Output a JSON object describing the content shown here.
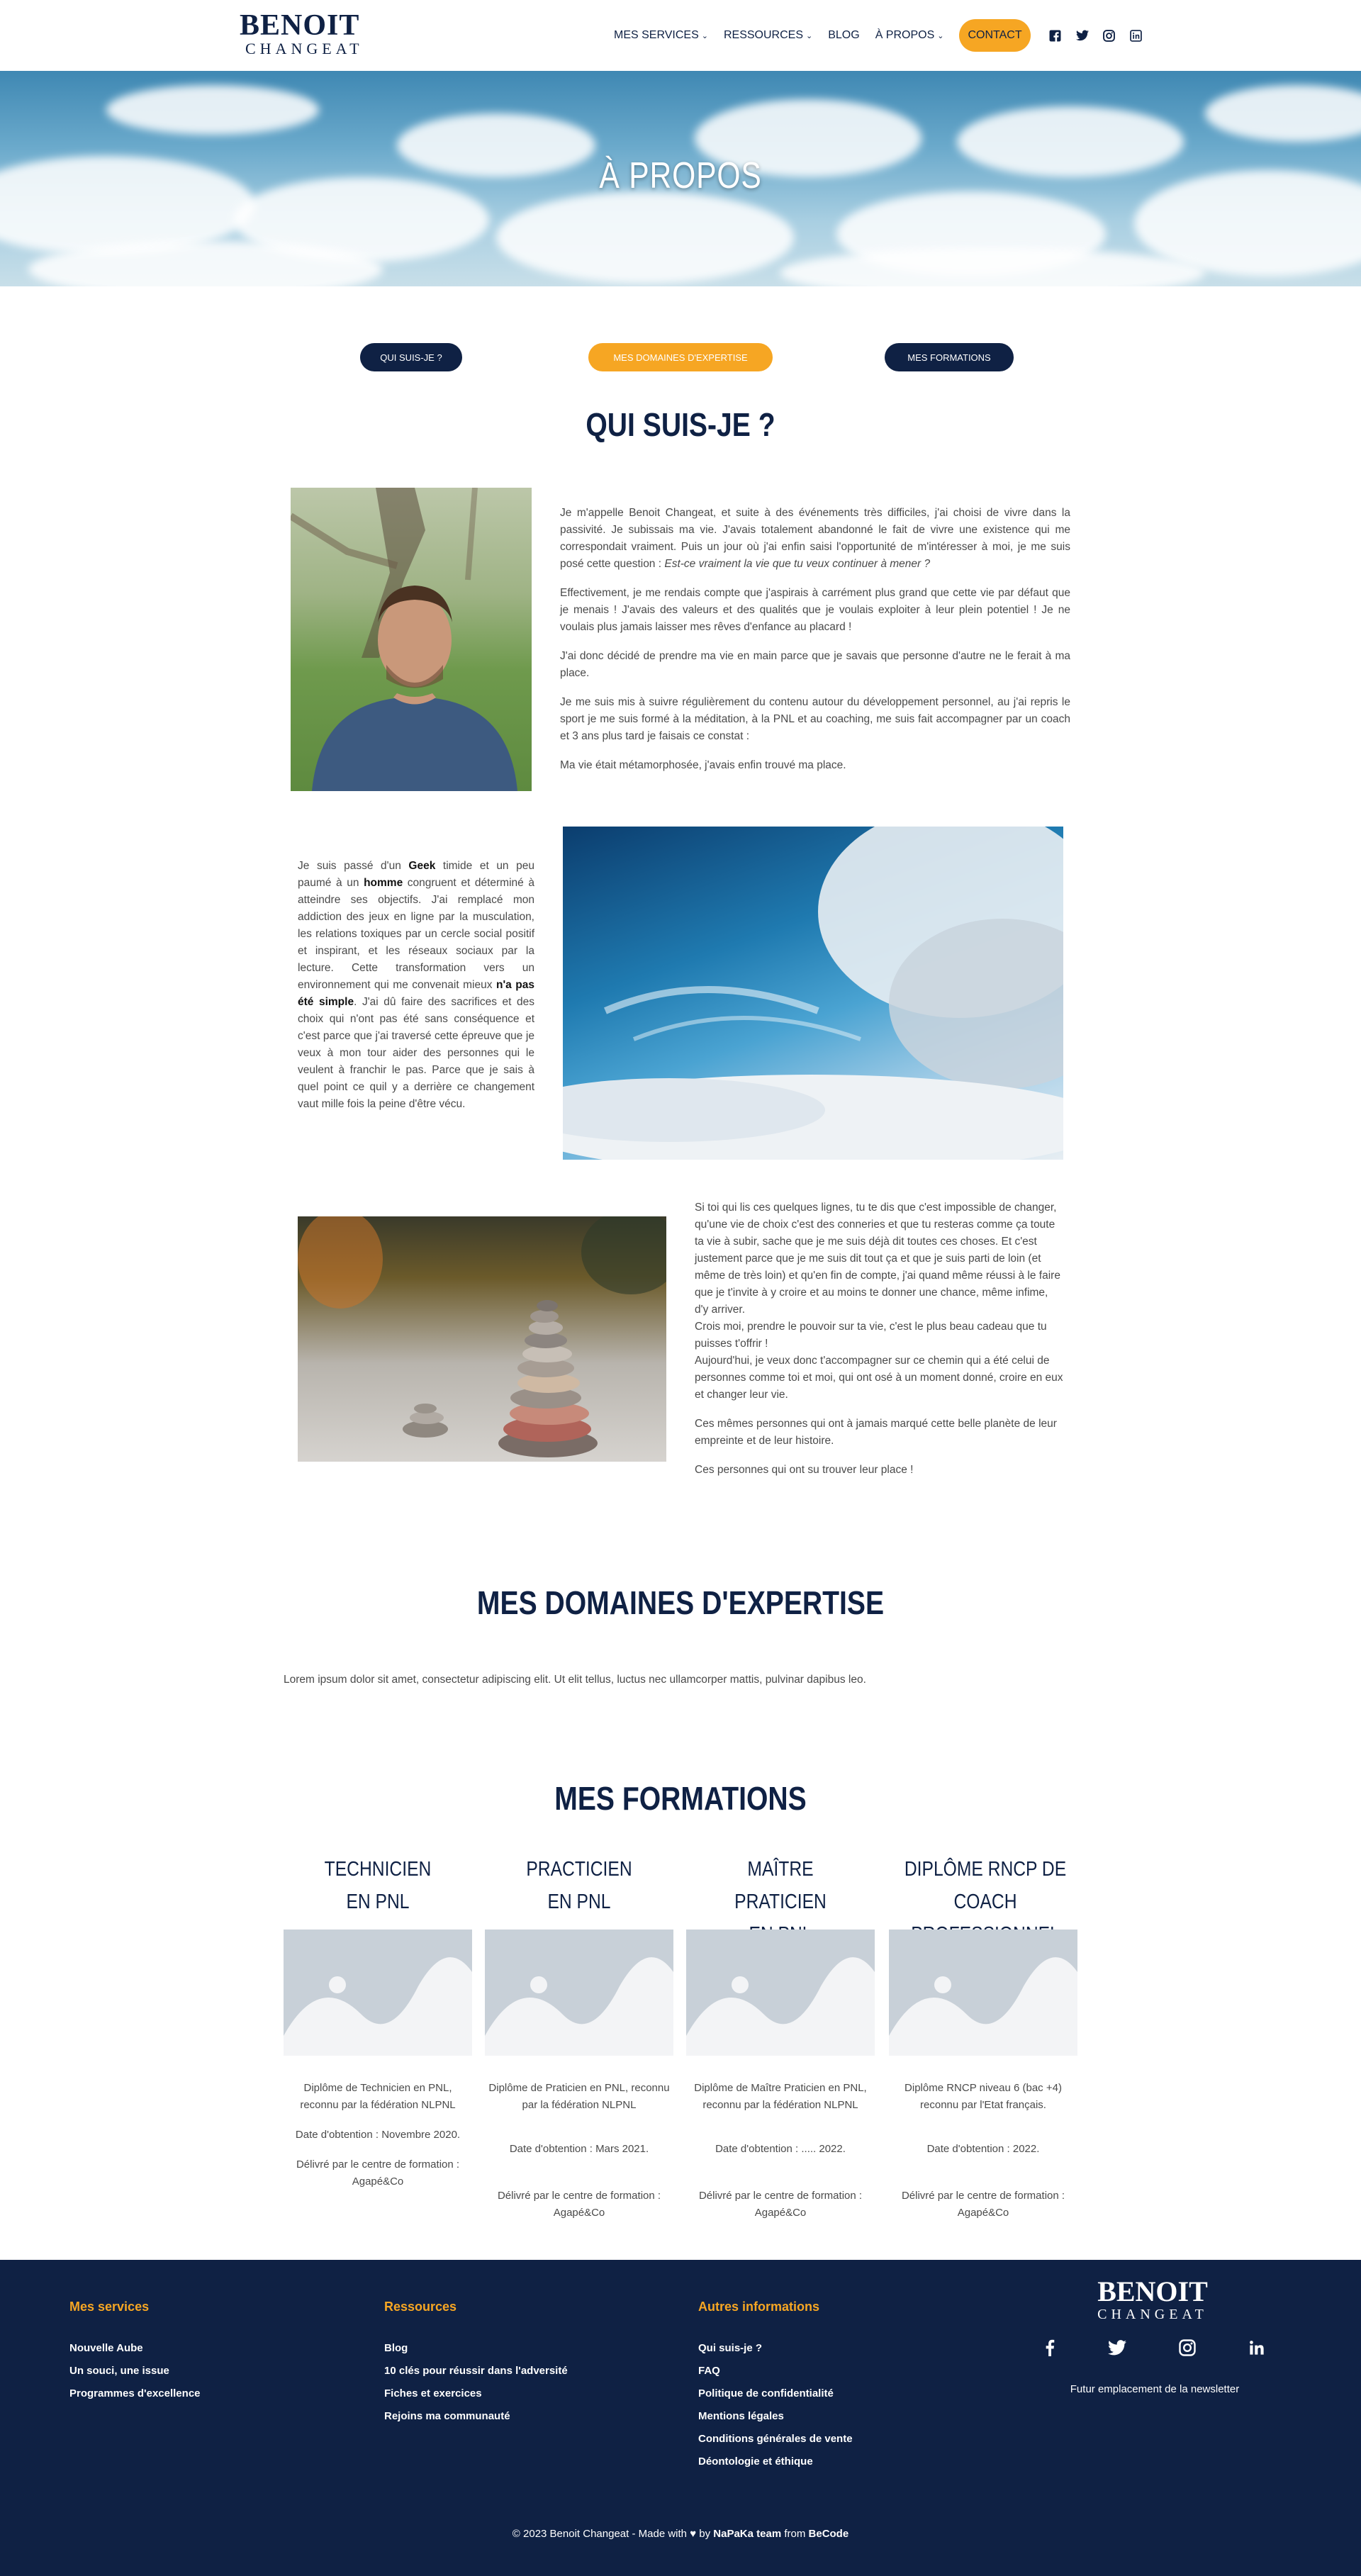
{
  "header": {
    "logo_top": "BENOIT",
    "logo_bottom": "CHANGEAT",
    "nav": [
      {
        "label": "MES SERVICES",
        "has_dropdown": true
      },
      {
        "label": "RESSOURCES",
        "has_dropdown": true
      },
      {
        "label": "BLOG",
        "has_dropdown": false
      },
      {
        "label": "À PROPOS",
        "has_dropdown": true
      }
    ],
    "contact_label": "CONTACT",
    "social_icons": [
      "facebook-icon",
      "twitter-icon",
      "instagram-icon",
      "linkedin-icon"
    ],
    "chevron": "⌄"
  },
  "hero": {
    "title": "À PROPOS"
  },
  "anchors": [
    {
      "label": "QUI SUIS-JE ?",
      "color": "#0f2144"
    },
    {
      "label": "MES DOMAINES D'EXPERTISE",
      "color": "#f6a623"
    },
    {
      "label": "MES FORMATIONS",
      "color": "#0f2144"
    }
  ],
  "qui": {
    "title": "QUI SUIS-JE ?",
    "p1_a": "Je m'appelle Benoit Changeat, et suite à des événements très difficiles, j'ai choisi de vivre dans la passivité. Je subissais ma vie. J'avais totalement abandonné le fait de vivre une existence qui me correspondait vraiment. Puis un jour où j'ai enfin saisi l'opportunité de m'intéresser à moi, je me suis posé cette question : ",
    "p1_em": "Est-ce vraiment la vie que tu veux continuer à mener ?",
    "p2": "Effectivement, je me rendais compte que j'aspirais à carrément plus grand que cette vie par défaut que je menais ! J'avais des valeurs et des qualités que je voulais exploiter à leur plein potentiel ! Je ne voulais plus jamais laisser mes rêves d'enfance au placard !",
    "p3": "J'ai donc décidé de prendre ma vie en main parce que je savais que personne d'autre ne le ferait à ma place.",
    "p4": "Je me suis mis à suivre régulièrement du contenu autour du développement personnel, au j'ai repris le sport je me suis formé à la méditation, à la PNL et au coaching, me suis fait accompagner par un coach et 3 ans plus tard je faisais ce constat :",
    "p5": "Ma vie était métamorphosée, j'avais enfin trouvé ma place.",
    "b1_a": "Je suis passé d'un ",
    "b1_geek": "Geek",
    "b1_b": " timide et un peu paumé à un ",
    "b1_homme": "homme",
    "b1_c": " congruent et déterminé à atteindre ses objectifs. J'ai remplacé mon addiction des jeux en ligne par la musculation, les relations toxiques par un cercle social positif et inspirant, et les réseaux sociaux par la lecture. Cette transformation vers un environnement qui me convenait mieux ",
    "b1_bold": "n'a pas été simple",
    "b1_d": ". J'ai dû faire des sacrifices et des choix qui n'ont pas été sans conséquence et c'est parce que j'ai traversé cette épreuve que je veux à mon tour aider des personnes qui le veulent à franchir le pas. Parce que je sais à quel point ce quil y a derrière ce changement vaut mille fois la peine d'être vécu.",
    "c1": "Si toi qui lis ces quelques lignes, tu te dis que c'est impossible de changer, qu'une vie de choix c'est des conneries et que tu resteras comme ça toute ta vie à subir, sache que je me suis déjà dit toutes ces choses. Et c'est justement parce que je me suis dit tout ça et que je suis parti de loin (et même de très loin) et qu'en fin de compte, j'ai quand même réussi à le faire que je t'invite à y croire et au moins te donner une chance, même infime, d'y arriver.",
    "c2": "Crois moi, prendre le pouvoir sur ta vie, c'est le plus beau cadeau que tu puisses t'offrir !",
    "c3": "Aujourd'hui, je veux donc t'accompagner sur ce chemin qui a été celui de personnes comme toi et moi, qui ont osé à un moment donné, croire en eux et changer leur vie.",
    "c4": "Ces mêmes personnes qui ont à jamais marqué cette belle planète de leur empreinte et de leur histoire.",
    "c5": "Ces personnes qui ont su trouver leur place !"
  },
  "expertise": {
    "title": "MES DOMAINES D'EXPERTISE",
    "text": "Lorem ipsum dolor sit amet, consectetur adipiscing elit. Ut elit tellus, luctus nec ullamcorper mattis, pulvinar dapibus leo."
  },
  "formations": {
    "title": "MES FORMATIONS",
    "cards": [
      {
        "t1": "TECHNICIEN",
        "t2": "EN PNL",
        "d1": "Diplôme de Technicien en PNL, reconnu par la fédération NLPNL",
        "d2": "Date d'obtention : Novembre 2020.",
        "d3": "Délivré par le centre de formation : Agapé&Co"
      },
      {
        "t1": "PRACTICIEN",
        "t2": "EN PNL",
        "d1": "Diplôme de Praticien en PNL, reconnu par la fédération NLPNL",
        "d2": "Date d'obtention : Mars 2021.",
        "d3": "Délivré par le centre de formation : Agapé&Co"
      },
      {
        "t1": "MAÎTRE PRATICIEN",
        "t2": "EN PNL",
        "d1": "Diplôme de Maître Praticien en PNL, reconnu par la fédération NLPNL",
        "d2": "Date d'obtention : ..... 2022.",
        "d3": "Délivré par le centre de formation : Agapé&Co"
      },
      {
        "t1": "DIPLÔME RNCP DE",
        "t2": "COACH PROFESSIONNEL",
        "d1": "Diplôme RNCP niveau 6 (bac +4) reconnu par l'Etat français.",
        "d2": "Date d'obtention : 2022.",
        "d3": "Délivré par le centre de formation : Agapé&Co"
      }
    ]
  },
  "footer": {
    "col1": {
      "title": "Mes services",
      "links": [
        "Nouvelle Aube",
        "Un souci, une issue",
        "Programmes d'excellence"
      ]
    },
    "col2": {
      "title": "Ressources",
      "links": [
        "Blog",
        "10 clés pour réussir dans l'adversité",
        "Fiches et exercices",
        "Rejoins ma communauté"
      ]
    },
    "col3": {
      "title": "Autres informations",
      "links": [
        "Qui suis-je ?",
        "FAQ",
        "Politique de confidentialité",
        "Mentions légales",
        "Conditions générales de vente",
        "Déontologie et éthique"
      ]
    },
    "logo_top": "BENOIT",
    "logo_bottom": "CHANGEAT",
    "newsletter": "Futur emplacement de la newsletter",
    "copyright_a": "© 2023 Benoit Changeat - Made with",
    "heart": "♥",
    "copyright_b": "by",
    "team": "NaPaKa team",
    "copyright_c": "from",
    "becode": "BeCode"
  },
  "colors": {
    "navy": "#0f2144",
    "orange": "#f6a623"
  }
}
